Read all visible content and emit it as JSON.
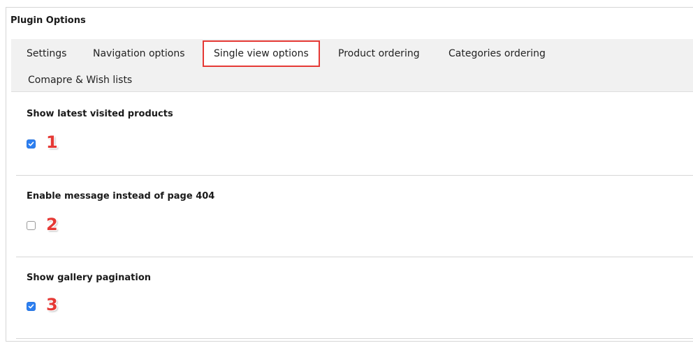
{
  "plugin": {
    "title": "Plugin Options"
  },
  "tabs": [
    {
      "label": "Settings",
      "active": false
    },
    {
      "label": "Navigation options",
      "active": false
    },
    {
      "label": "Single view options",
      "active": true
    },
    {
      "label": "Product ordering",
      "active": false
    },
    {
      "label": "Categories ordering",
      "active": false
    },
    {
      "label": "Comapre & Wish lists",
      "active": false
    }
  ],
  "options": [
    {
      "title": "Show latest visited products",
      "checked": true,
      "marker": "1"
    },
    {
      "title": "Enable message instead of page 404",
      "checked": false,
      "marker": "2"
    },
    {
      "title": "Show gallery pagination",
      "checked": true,
      "marker": "3"
    }
  ],
  "colors": {
    "accent": "#e53935",
    "checkbox": "#2d7ff0"
  }
}
